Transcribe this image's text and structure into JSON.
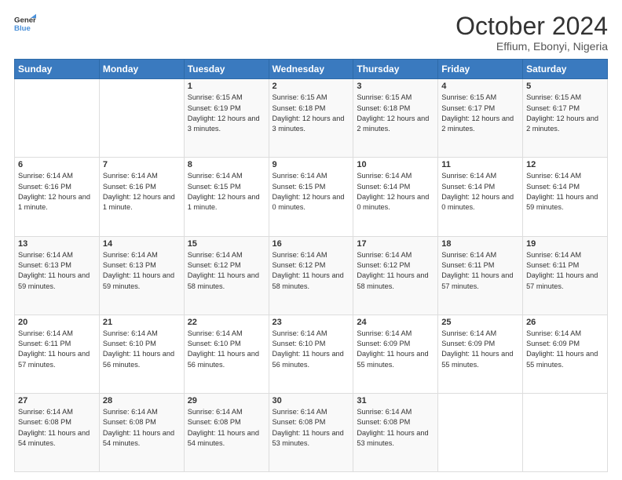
{
  "logo": {
    "line1": "General",
    "line2": "Blue"
  },
  "title": "October 2024",
  "subtitle": "Effium, Ebonyi, Nigeria",
  "days_of_week": [
    "Sunday",
    "Monday",
    "Tuesday",
    "Wednesday",
    "Thursday",
    "Friday",
    "Saturday"
  ],
  "weeks": [
    [
      null,
      null,
      {
        "day": "1",
        "sunrise": "Sunrise: 6:15 AM",
        "sunset": "Sunset: 6:19 PM",
        "daylight": "Daylight: 12 hours and 3 minutes."
      },
      {
        "day": "2",
        "sunrise": "Sunrise: 6:15 AM",
        "sunset": "Sunset: 6:18 PM",
        "daylight": "Daylight: 12 hours and 3 minutes."
      },
      {
        "day": "3",
        "sunrise": "Sunrise: 6:15 AM",
        "sunset": "Sunset: 6:18 PM",
        "daylight": "Daylight: 12 hours and 2 minutes."
      },
      {
        "day": "4",
        "sunrise": "Sunrise: 6:15 AM",
        "sunset": "Sunset: 6:17 PM",
        "daylight": "Daylight: 12 hours and 2 minutes."
      },
      {
        "day": "5",
        "sunrise": "Sunrise: 6:15 AM",
        "sunset": "Sunset: 6:17 PM",
        "daylight": "Daylight: 12 hours and 2 minutes."
      }
    ],
    [
      {
        "day": "6",
        "sunrise": "Sunrise: 6:14 AM",
        "sunset": "Sunset: 6:16 PM",
        "daylight": "Daylight: 12 hours and 1 minute."
      },
      {
        "day": "7",
        "sunrise": "Sunrise: 6:14 AM",
        "sunset": "Sunset: 6:16 PM",
        "daylight": "Daylight: 12 hours and 1 minute."
      },
      {
        "day": "8",
        "sunrise": "Sunrise: 6:14 AM",
        "sunset": "Sunset: 6:15 PM",
        "daylight": "Daylight: 12 hours and 1 minute."
      },
      {
        "day": "9",
        "sunrise": "Sunrise: 6:14 AM",
        "sunset": "Sunset: 6:15 PM",
        "daylight": "Daylight: 12 hours and 0 minutes."
      },
      {
        "day": "10",
        "sunrise": "Sunrise: 6:14 AM",
        "sunset": "Sunset: 6:14 PM",
        "daylight": "Daylight: 12 hours and 0 minutes."
      },
      {
        "day": "11",
        "sunrise": "Sunrise: 6:14 AM",
        "sunset": "Sunset: 6:14 PM",
        "daylight": "Daylight: 12 hours and 0 minutes."
      },
      {
        "day": "12",
        "sunrise": "Sunrise: 6:14 AM",
        "sunset": "Sunset: 6:14 PM",
        "daylight": "Daylight: 11 hours and 59 minutes."
      }
    ],
    [
      {
        "day": "13",
        "sunrise": "Sunrise: 6:14 AM",
        "sunset": "Sunset: 6:13 PM",
        "daylight": "Daylight: 11 hours and 59 minutes."
      },
      {
        "day": "14",
        "sunrise": "Sunrise: 6:14 AM",
        "sunset": "Sunset: 6:13 PM",
        "daylight": "Daylight: 11 hours and 59 minutes."
      },
      {
        "day": "15",
        "sunrise": "Sunrise: 6:14 AM",
        "sunset": "Sunset: 6:12 PM",
        "daylight": "Daylight: 11 hours and 58 minutes."
      },
      {
        "day": "16",
        "sunrise": "Sunrise: 6:14 AM",
        "sunset": "Sunset: 6:12 PM",
        "daylight": "Daylight: 11 hours and 58 minutes."
      },
      {
        "day": "17",
        "sunrise": "Sunrise: 6:14 AM",
        "sunset": "Sunset: 6:12 PM",
        "daylight": "Daylight: 11 hours and 58 minutes."
      },
      {
        "day": "18",
        "sunrise": "Sunrise: 6:14 AM",
        "sunset": "Sunset: 6:11 PM",
        "daylight": "Daylight: 11 hours and 57 minutes."
      },
      {
        "day": "19",
        "sunrise": "Sunrise: 6:14 AM",
        "sunset": "Sunset: 6:11 PM",
        "daylight": "Daylight: 11 hours and 57 minutes."
      }
    ],
    [
      {
        "day": "20",
        "sunrise": "Sunrise: 6:14 AM",
        "sunset": "Sunset: 6:11 PM",
        "daylight": "Daylight: 11 hours and 57 minutes."
      },
      {
        "day": "21",
        "sunrise": "Sunrise: 6:14 AM",
        "sunset": "Sunset: 6:10 PM",
        "daylight": "Daylight: 11 hours and 56 minutes."
      },
      {
        "day": "22",
        "sunrise": "Sunrise: 6:14 AM",
        "sunset": "Sunset: 6:10 PM",
        "daylight": "Daylight: 11 hours and 56 minutes."
      },
      {
        "day": "23",
        "sunrise": "Sunrise: 6:14 AM",
        "sunset": "Sunset: 6:10 PM",
        "daylight": "Daylight: 11 hours and 56 minutes."
      },
      {
        "day": "24",
        "sunrise": "Sunrise: 6:14 AM",
        "sunset": "Sunset: 6:09 PM",
        "daylight": "Daylight: 11 hours and 55 minutes."
      },
      {
        "day": "25",
        "sunrise": "Sunrise: 6:14 AM",
        "sunset": "Sunset: 6:09 PM",
        "daylight": "Daylight: 11 hours and 55 minutes."
      },
      {
        "day": "26",
        "sunrise": "Sunrise: 6:14 AM",
        "sunset": "Sunset: 6:09 PM",
        "daylight": "Daylight: 11 hours and 55 minutes."
      }
    ],
    [
      {
        "day": "27",
        "sunrise": "Sunrise: 6:14 AM",
        "sunset": "Sunset: 6:08 PM",
        "daylight": "Daylight: 11 hours and 54 minutes."
      },
      {
        "day": "28",
        "sunrise": "Sunrise: 6:14 AM",
        "sunset": "Sunset: 6:08 PM",
        "daylight": "Daylight: 11 hours and 54 minutes."
      },
      {
        "day": "29",
        "sunrise": "Sunrise: 6:14 AM",
        "sunset": "Sunset: 6:08 PM",
        "daylight": "Daylight: 11 hours and 54 minutes."
      },
      {
        "day": "30",
        "sunrise": "Sunrise: 6:14 AM",
        "sunset": "Sunset: 6:08 PM",
        "daylight": "Daylight: 11 hours and 53 minutes."
      },
      {
        "day": "31",
        "sunrise": "Sunrise: 6:14 AM",
        "sunset": "Sunset: 6:08 PM",
        "daylight": "Daylight: 11 hours and 53 minutes."
      },
      null,
      null
    ]
  ]
}
